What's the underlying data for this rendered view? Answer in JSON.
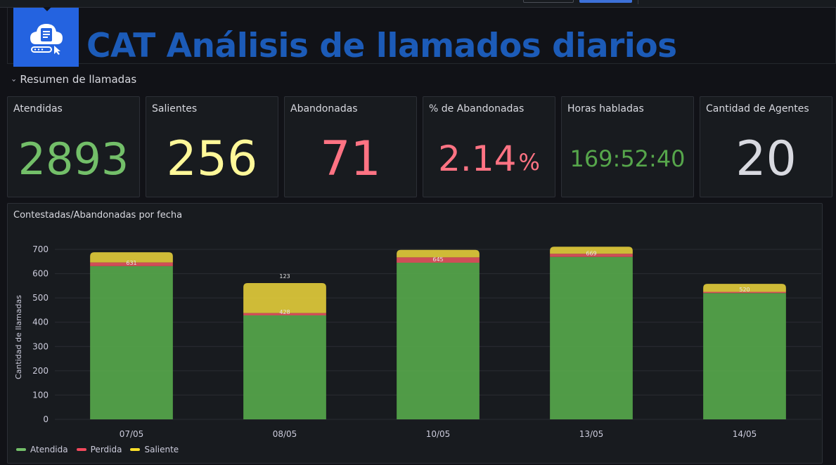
{
  "header": {
    "title": "CAT Análisis de llamados diarios",
    "logo_icon": "cloud-document-icon"
  },
  "row": {
    "chevron": "›",
    "title": "Resumen de llamadas"
  },
  "stats": [
    {
      "label": "Atendidas",
      "value": "2893",
      "unit": "",
      "color": "#73bf69"
    },
    {
      "label": "Salientes",
      "value": "256",
      "unit": "",
      "color": "#fade2a"
    },
    {
      "label": "Abandonadas",
      "value": "71",
      "unit": "",
      "color": "#f2495c"
    },
    {
      "label": "% de Abandonadas",
      "value": "2.14",
      "unit": "%",
      "color": "#f2495c"
    },
    {
      "label": "Horas habladas",
      "value": "169:52:40",
      "unit": "",
      "color": "#56a64b"
    },
    {
      "label": "Cantidad de Agentes",
      "value": "20",
      "unit": "",
      "color": "#d8d9e0"
    }
  ],
  "chart_panel": {
    "title": "Contestadas/Abandonadas por fecha"
  },
  "chart_data": {
    "type": "bar",
    "stacked": true,
    "title": "Contestadas/Abandonadas por fecha",
    "xlabel": "",
    "ylabel": "Cantidad de llamadas",
    "ylim": [
      0,
      700
    ],
    "yticks": [
      0,
      100,
      200,
      300,
      400,
      500,
      600,
      700
    ],
    "grid": true,
    "legend_position": "bottom-left",
    "categories": [
      "07/05",
      "08/05",
      "10/05",
      "13/05",
      "14/05"
    ],
    "series": [
      {
        "name": "Atendida",
        "color": "#56a64b",
        "values": [
          631,
          428,
          645,
          669,
          520
        ],
        "labels": [
          "631",
          "428",
          "645",
          "669",
          "520"
        ]
      },
      {
        "name": "Perdida",
        "color": "#e0535c",
        "values": [
          15,
          10,
          22,
          13,
          5
        ],
        "labels": [
          "",
          "",
          "",
          "",
          ""
        ]
      },
      {
        "name": "Saliente",
        "color": "#e0c93a",
        "values": [
          42,
          123,
          31,
          29,
          33
        ],
        "labels": [
          "",
          "123",
          "",
          "",
          ""
        ]
      }
    ]
  }
}
